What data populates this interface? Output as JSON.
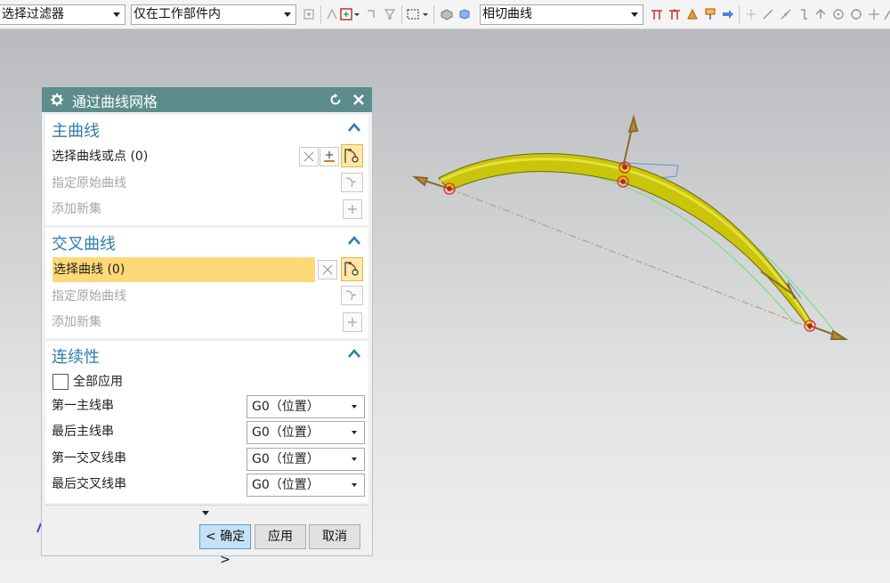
{
  "toolbar": {
    "filter_select": "选择过滤器",
    "scope_select": "仅在工作部件内",
    "curve_rule_select": "相切曲线"
  },
  "dialog": {
    "title": "通过曲线网格",
    "sections": {
      "primary": {
        "title": "主曲线",
        "select_curve": "选择曲线或点 (0)",
        "specify_origin": "指定原始曲线",
        "add_set": "添加新集"
      },
      "cross": {
        "title": "交叉曲线",
        "select_curve": "选择曲线 (0)",
        "specify_origin": "指定原始曲线",
        "add_set": "添加新集"
      },
      "continuity": {
        "title": "连续性",
        "apply_all": "全部应用",
        "rows": [
          {
            "label": "第一主线串",
            "value": "G0（位置）"
          },
          {
            "label": "最后主线串",
            "value": "G0（位置）"
          },
          {
            "label": "第一交叉线串",
            "value": "G0（位置）"
          },
          {
            "label": "最后交叉线串",
            "value": "G0（位置）"
          }
        ]
      }
    },
    "buttons": {
      "ok": "< 确定 >",
      "apply": "应用",
      "cancel": "取消"
    }
  },
  "colors": {
    "accent": "#2e7ea8",
    "title_bar": "#5c8c8c",
    "highlight": "#ffd978",
    "surface": "#c9c50a"
  }
}
